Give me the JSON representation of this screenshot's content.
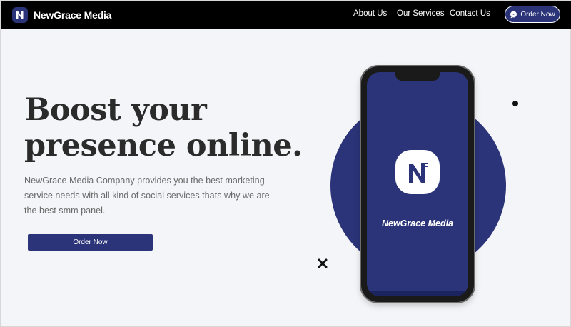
{
  "nav": {
    "brand_name": "NewGrace Media",
    "links": [
      "About Us",
      "Our Services",
      "Contact Us"
    ],
    "order_button": "Order Now"
  },
  "hero": {
    "title_line1": "Boost your",
    "title_line2": "presence online.",
    "description": "NewGrace Media Company provides you the best marketing service needs with all kind of social services thats why we are the best smm panel.",
    "order_button": "Order Now"
  },
  "phone": {
    "app_name": "NewGrace Media"
  },
  "colors": {
    "brand": "#2b3478",
    "nav_background": "#000000",
    "page_background": "#f4f5f8"
  },
  "icons": {
    "logo": "newgrace-logo-icon",
    "chat": "chat-bubble-icon",
    "dot": "dot-decoration",
    "cross": "x-decoration"
  }
}
